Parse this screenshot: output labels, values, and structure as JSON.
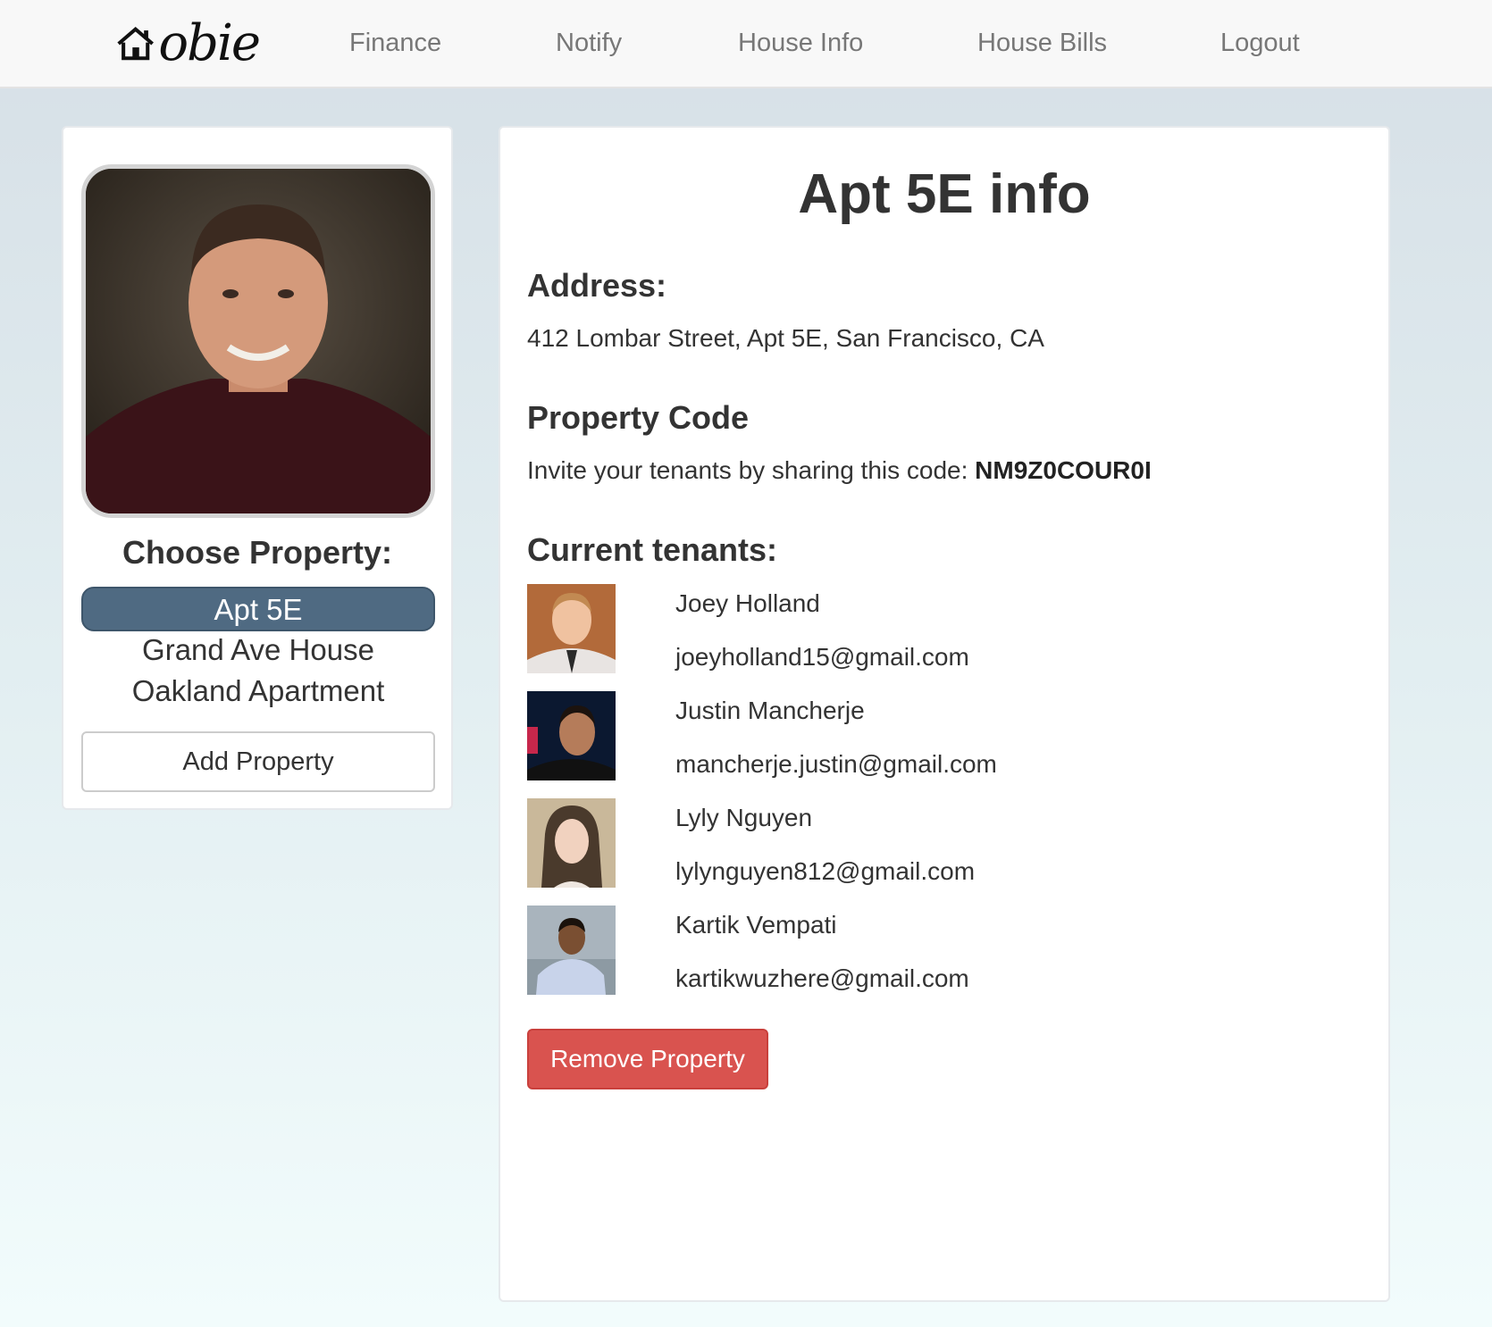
{
  "navbar": {
    "logo_text": "obie",
    "links": [
      "Finance",
      "Notify",
      "House Info",
      "House Bills",
      "Logout"
    ]
  },
  "sidebar": {
    "choose_title": "Choose Property:",
    "properties": [
      "Apt 5E",
      "Grand Ave House",
      "Oakland Apartment"
    ],
    "selected_property": "Apt 5E",
    "add_button": "Add Property"
  },
  "main": {
    "title": "Apt 5E info",
    "address_heading": "Address:",
    "address": "412 Lombar Street, Apt 5E, San Francisco, CA",
    "code_heading": "Property Code",
    "code_prefix": "Invite your tenants by sharing this code: ",
    "code": "NM9Z0COUR0I",
    "tenants_heading": "Current tenants:",
    "tenants": [
      {
        "name": "Joey Holland",
        "email": "joeyholland15@gmail.com"
      },
      {
        "name": "Justin Mancherje",
        "email": "mancherje.justin@gmail.com"
      },
      {
        "name": "Lyly Nguyen",
        "email": "lylynguyen812@gmail.com"
      },
      {
        "name": "Kartik Vempati",
        "email": "kartikwuzhere@gmail.com"
      }
    ],
    "remove_button": "Remove Property"
  },
  "colors": {
    "accent_selected": "#4f6a82",
    "danger": "#d9534f",
    "nav_text": "#777777"
  }
}
